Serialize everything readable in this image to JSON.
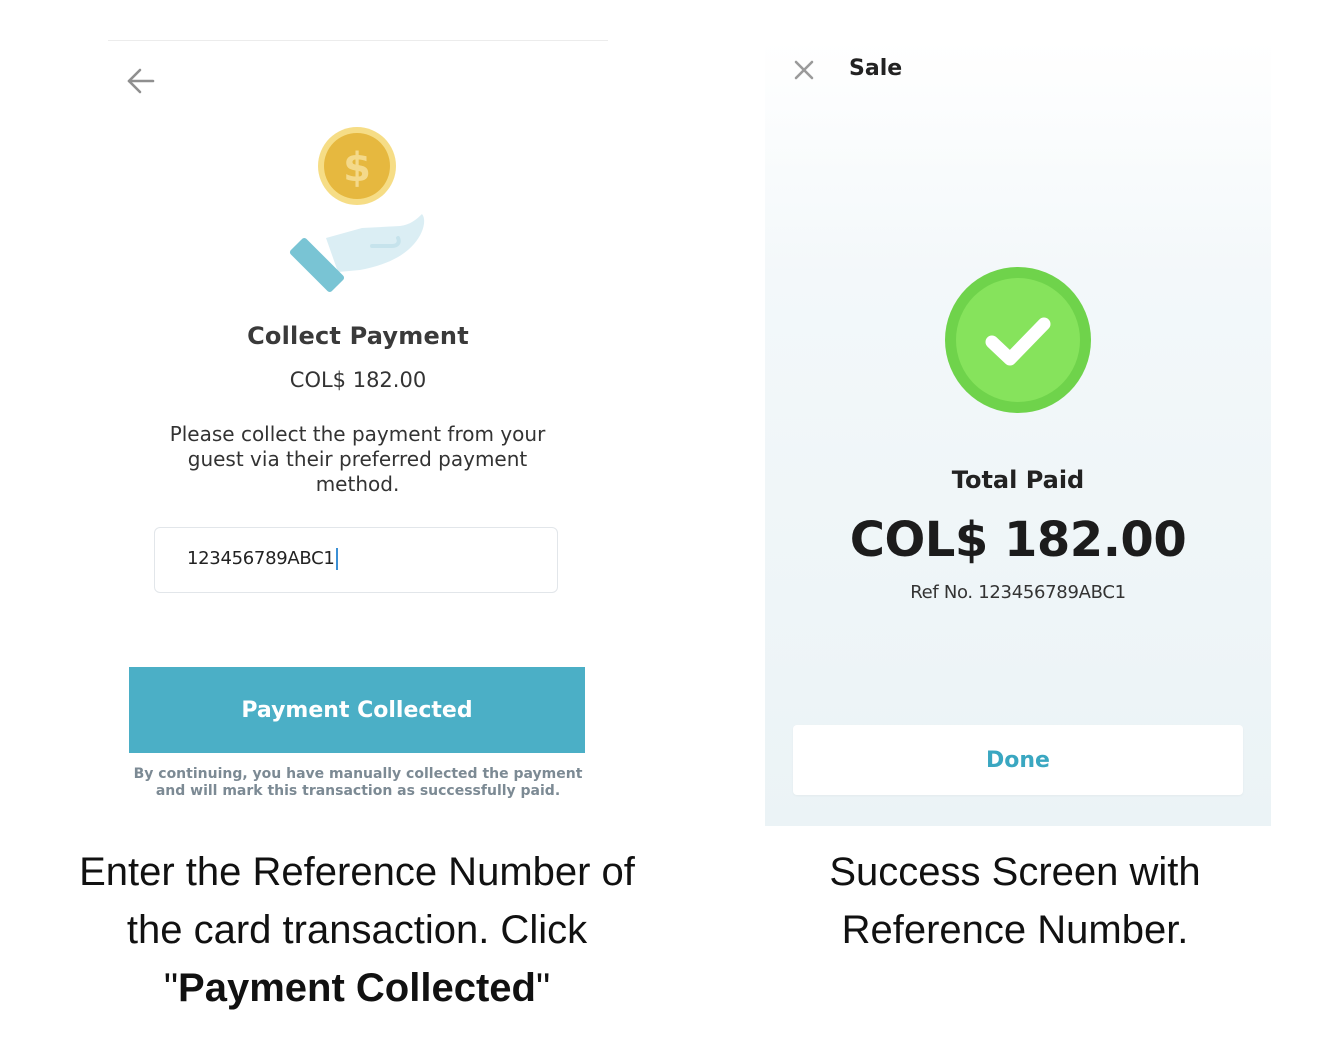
{
  "left_screen": {
    "title": "Collect Payment",
    "amount": "COL$ 182.00",
    "instructions": "Please collect the payment from your guest via their preferred payment method.",
    "reference_input_value": "123456789ABC1",
    "primary_button_label": "Payment Collected",
    "disclaimer": "By continuing, you have manually collected the payment and will mark this transaction as successfully paid."
  },
  "right_screen": {
    "header_title": "Sale",
    "total_paid_label": "Total Paid",
    "total_paid_amount": "COL$ 182.00",
    "reference_text": "Ref No. 123456789ABC1",
    "done_button_label": "Done"
  },
  "captions": {
    "left_line1": "Enter the Reference Number of the card transaction. Click",
    "left_quote_open": "\"",
    "left_bold": "Payment Collected",
    "left_quote_close": "\"",
    "right": "Success Screen with Reference Number."
  },
  "icons": {
    "back": "arrow-left-icon",
    "close": "close-icon",
    "coin": "dollar-coin-icon",
    "hand": "open-hand-icon",
    "success": "check-circle-icon"
  },
  "colors": {
    "primary_button": "#4bafc6",
    "done_text": "#3aa7c1",
    "success_green": "#7ed957",
    "coin_gold": "#e6b83f"
  }
}
